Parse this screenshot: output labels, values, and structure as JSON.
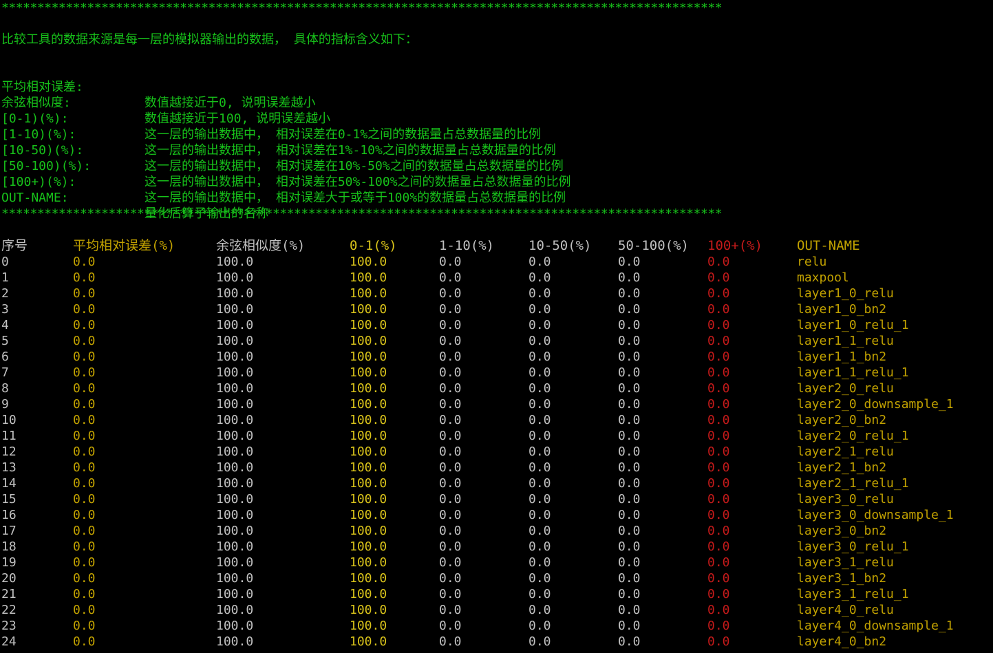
{
  "stars": "*****************************************************************************************************",
  "intro": "比较工具的数据来源是每一层的模拟器输出的数据， 具体的指标含义如下：",
  "legend": [
    {
      "key": "平均相对误差:",
      "value": "数值越接近于0, 说明误差越小"
    },
    {
      "key": "余弦相似度:",
      "value": "数值越接近于100, 说明误差越小"
    },
    {
      "key": "[0-1)(%):",
      "value": "这一层的输出数据中， 相对误差在0-1%之间的数据量占总数据量的比例"
    },
    {
      "key": "[1-10)(%):",
      "value": "这一层的输出数据中， 相对误差在1%-10%之间的数据量占总数据量的比例"
    },
    {
      "key": "[10-50)(%):",
      "value": "这一层的输出数据中， 相对误差在10%-50%之间的数据量占总数据量的比例"
    },
    {
      "key": "[50-100)(%):",
      "value": "这一层的输出数据中， 相对误差在50%-100%之间的数据量占总数据量的比例"
    },
    {
      "key": "[100+)(%):",
      "value": "这一层的输出数据中， 相对误差大于或等于100%的数据量占总数据量的比例"
    },
    {
      "key": "OUT-NAME:",
      "value": "量化后算子输出的名称"
    }
  ],
  "table": {
    "headers": [
      "序号",
      "平均相对误差(%)",
      "余弦相似度(%)",
      "0-1(%)",
      "1-10(%)",
      "10-50(%)",
      "50-100(%)",
      "100+(%)",
      "OUT-NAME"
    ],
    "rows": [
      [
        "0",
        "0.0",
        "100.0",
        "100.0",
        "0.0",
        "0.0",
        "0.0",
        "0.0",
        "relu"
      ],
      [
        "1",
        "0.0",
        "100.0",
        "100.0",
        "0.0",
        "0.0",
        "0.0",
        "0.0",
        "maxpool"
      ],
      [
        "2",
        "0.0",
        "100.0",
        "100.0",
        "0.0",
        "0.0",
        "0.0",
        "0.0",
        "layer1_0_relu"
      ],
      [
        "3",
        "0.0",
        "100.0",
        "100.0",
        "0.0",
        "0.0",
        "0.0",
        "0.0",
        "layer1_0_bn2"
      ],
      [
        "4",
        "0.0",
        "100.0",
        "100.0",
        "0.0",
        "0.0",
        "0.0",
        "0.0",
        "layer1_0_relu_1"
      ],
      [
        "5",
        "0.0",
        "100.0",
        "100.0",
        "0.0",
        "0.0",
        "0.0",
        "0.0",
        "layer1_1_relu"
      ],
      [
        "6",
        "0.0",
        "100.0",
        "100.0",
        "0.0",
        "0.0",
        "0.0",
        "0.0",
        "layer1_1_bn2"
      ],
      [
        "7",
        "0.0",
        "100.0",
        "100.0",
        "0.0",
        "0.0",
        "0.0",
        "0.0",
        "layer1_1_relu_1"
      ],
      [
        "8",
        "0.0",
        "100.0",
        "100.0",
        "0.0",
        "0.0",
        "0.0",
        "0.0",
        "layer2_0_relu"
      ],
      [
        "9",
        "0.0",
        "100.0",
        "100.0",
        "0.0",
        "0.0",
        "0.0",
        "0.0",
        "layer2_0_downsample_1"
      ],
      [
        "10",
        "0.0",
        "100.0",
        "100.0",
        "0.0",
        "0.0",
        "0.0",
        "0.0",
        "layer2_0_bn2"
      ],
      [
        "11",
        "0.0",
        "100.0",
        "100.0",
        "0.0",
        "0.0",
        "0.0",
        "0.0",
        "layer2_0_relu_1"
      ],
      [
        "12",
        "0.0",
        "100.0",
        "100.0",
        "0.0",
        "0.0",
        "0.0",
        "0.0",
        "layer2_1_relu"
      ],
      [
        "13",
        "0.0",
        "100.0",
        "100.0",
        "0.0",
        "0.0",
        "0.0",
        "0.0",
        "layer2_1_bn2"
      ],
      [
        "14",
        "0.0",
        "100.0",
        "100.0",
        "0.0",
        "0.0",
        "0.0",
        "0.0",
        "layer2_1_relu_1"
      ],
      [
        "15",
        "0.0",
        "100.0",
        "100.0",
        "0.0",
        "0.0",
        "0.0",
        "0.0",
        "layer3_0_relu"
      ],
      [
        "16",
        "0.0",
        "100.0",
        "100.0",
        "0.0",
        "0.0",
        "0.0",
        "0.0",
        "layer3_0_downsample_1"
      ],
      [
        "17",
        "0.0",
        "100.0",
        "100.0",
        "0.0",
        "0.0",
        "0.0",
        "0.0",
        "layer3_0_bn2"
      ],
      [
        "18",
        "0.0",
        "100.0",
        "100.0",
        "0.0",
        "0.0",
        "0.0",
        "0.0",
        "layer3_0_relu_1"
      ],
      [
        "19",
        "0.0",
        "100.0",
        "100.0",
        "0.0",
        "0.0",
        "0.0",
        "0.0",
        "layer3_1_relu"
      ],
      [
        "20",
        "0.0",
        "100.0",
        "100.0",
        "0.0",
        "0.0",
        "0.0",
        "0.0",
        "layer3_1_bn2"
      ],
      [
        "21",
        "0.0",
        "100.0",
        "100.0",
        "0.0",
        "0.0",
        "0.0",
        "0.0",
        "layer3_1_relu_1"
      ],
      [
        "22",
        "0.0",
        "100.0",
        "100.0",
        "0.0",
        "0.0",
        "0.0",
        "0.0",
        "layer4_0_relu"
      ],
      [
        "23",
        "0.0",
        "100.0",
        "100.0",
        "0.0",
        "0.0",
        "0.0",
        "0.0",
        "layer4_0_downsample_1"
      ],
      [
        "24",
        "0.0",
        "100.0",
        "100.0",
        "0.0",
        "0.0",
        "0.0",
        "0.0",
        "layer4_0_bn2"
      ]
    ]
  },
  "colors": {
    "background": "#000000",
    "green": "#17c11a",
    "white": "#c0c0c0",
    "yellow": "#c1a100",
    "yellow_bright": "#d8c21a",
    "red": "#c41a1a"
  }
}
